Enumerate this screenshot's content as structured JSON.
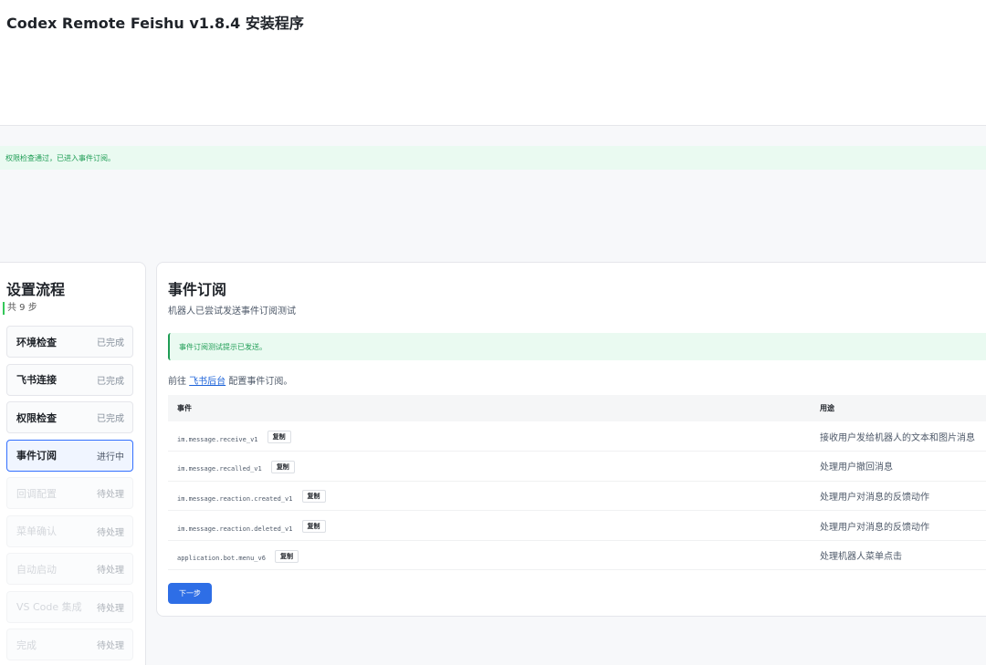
{
  "header": {
    "title": "Codex Remote Feishu v1.8.4 安装程序"
  },
  "notice": "权限检查通过，已进入事件订阅。",
  "sidebar": {
    "title": "设置流程",
    "step_count": "共 9 步",
    "steps": [
      {
        "name": "环境检查",
        "status": "已完成",
        "state": "done"
      },
      {
        "name": "飞书连接",
        "status": "已完成",
        "state": "done"
      },
      {
        "name": "权限检查",
        "status": "已完成",
        "state": "done"
      },
      {
        "name": "事件订阅",
        "status": "进行中",
        "state": "active"
      },
      {
        "name": "回调配置",
        "status": "待处理",
        "state": "pending"
      },
      {
        "name": "菜单确认",
        "status": "待处理",
        "state": "pending"
      },
      {
        "name": "自动启动",
        "status": "待处理",
        "state": "pending"
      },
      {
        "name": "VS Code 集成",
        "status": "待处理",
        "state": "pending"
      },
      {
        "name": "完成",
        "status": "待处理",
        "state": "pending"
      }
    ]
  },
  "main": {
    "title": "事件订阅",
    "subtitle": "机器人已尝试发送事件订阅测试",
    "success": "事件订阅测试提示已发送。",
    "goto_prefix": "前往",
    "goto_link": "飞书后台",
    "goto_suffix": "配置事件订阅。",
    "table": {
      "headers": [
        "事件",
        "用途"
      ],
      "copy_label": "复制",
      "rows": [
        {
          "event": "im.message.receive_v1",
          "usage": "接收用户发给机器人的文本和图片消息"
        },
        {
          "event": "im.message.recalled_v1",
          "usage": "处理用户撤回消息"
        },
        {
          "event": "im.message.reaction.created_v1",
          "usage": "处理用户对消息的反馈动作"
        },
        {
          "event": "im.message.reaction.deleted_v1",
          "usage": "处理用户对消息的反馈动作"
        },
        {
          "event": "application.bot.menu_v6",
          "usage": "处理机器人菜单点击"
        }
      ]
    },
    "next_button": "下一步"
  },
  "colors": {
    "accent": "#2e6ee6",
    "success_bg": "#eafaf1",
    "success_text": "#1f9d55",
    "link": "#1d63d9"
  }
}
